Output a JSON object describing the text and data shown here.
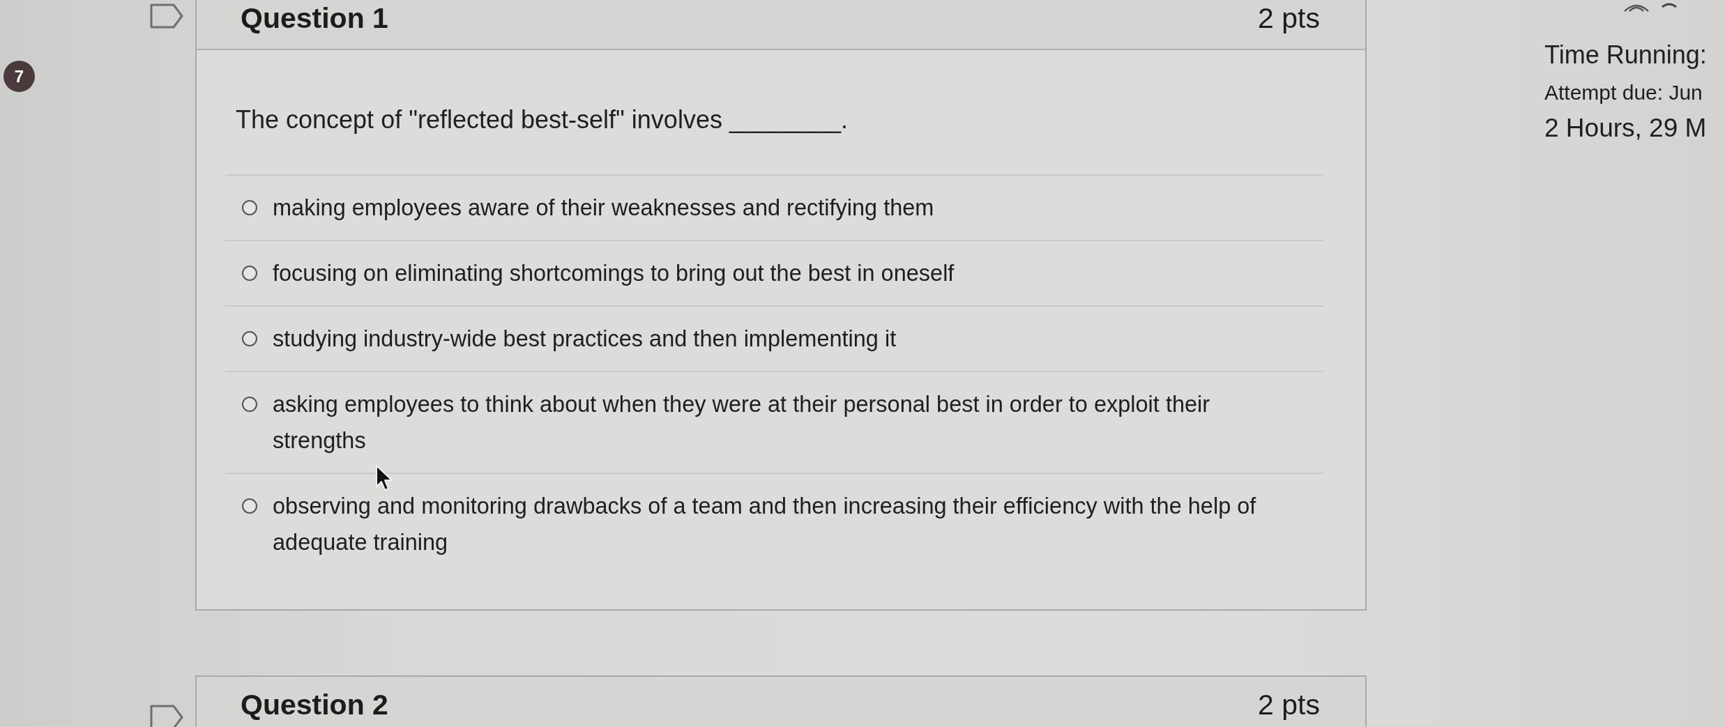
{
  "question_number_badge": {
    "text": "7"
  },
  "questions": [
    {
      "title": "Question 1",
      "points": "2 pts",
      "flagged": false,
      "prompt": "The concept of \"reflected best-self\" involves ________.",
      "options": [
        {
          "text": "making employees aware of their weaknesses and rectifying them",
          "selected": false
        },
        {
          "text": "focusing on eliminating shortcomings to bring out the best in oneself",
          "selected": false
        },
        {
          "text": "studying industry-wide best practices and then implementing it",
          "selected": false
        },
        {
          "text": "asking employees to think about when they were at their personal best in order to exploit their strengths",
          "selected": false
        },
        {
          "text": "observing and monitoring drawbacks of a team and then increasing their efficiency with the help of adequate training",
          "selected": false
        }
      ]
    },
    {
      "title": "Question 2",
      "points": "2 pts",
      "flagged": false
    }
  ],
  "timer": {
    "heading": "Time Running:",
    "due": "Attempt due: Jun",
    "remaining": "2 Hours, 29 M"
  }
}
